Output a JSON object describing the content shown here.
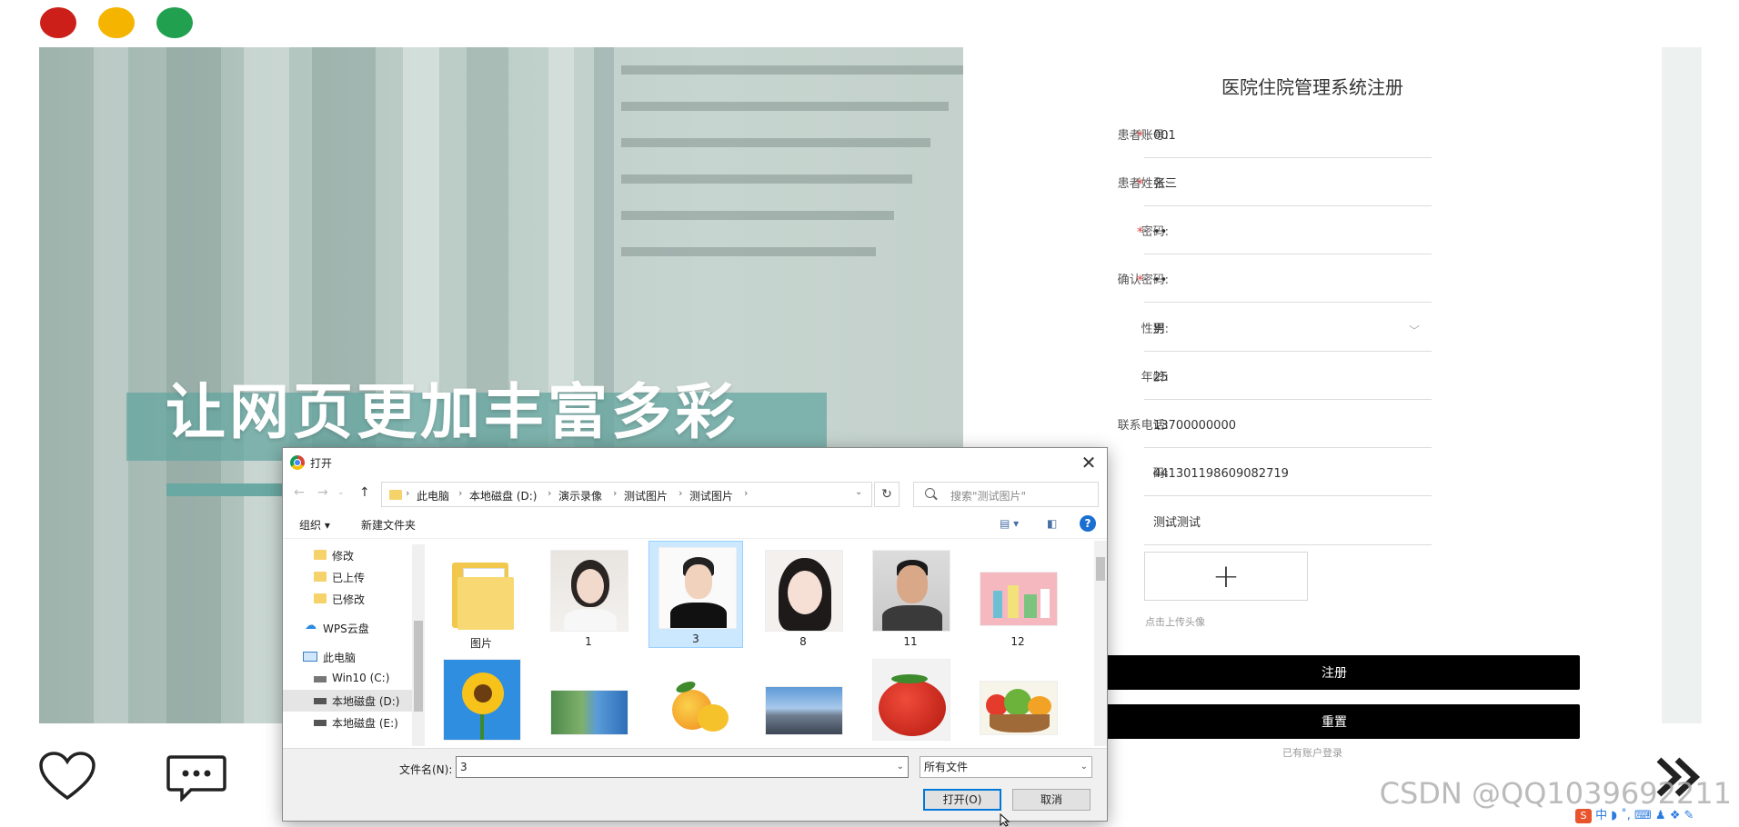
{
  "register": {
    "title": "医院住院管理系统注册",
    "fields": [
      {
        "label": "患者账号:",
        "required": true,
        "value": "001"
      },
      {
        "label": "患者姓名:",
        "required": true,
        "value": "张三"
      },
      {
        "label": "密码:",
        "required": true,
        "value": "••"
      },
      {
        "label": "确认密码:",
        "required": true,
        "value": "••"
      },
      {
        "label": "性别:",
        "required": false,
        "value": "男",
        "select": true
      },
      {
        "label": "年龄:",
        "required": false,
        "value": "25"
      },
      {
        "label": "联系电话:",
        "required": false,
        "value": "13700000000"
      },
      {
        "label": "码:",
        "required": false,
        "value": "441301198609082719"
      },
      {
        "label": ":",
        "required": false,
        "value": "测试测试"
      }
    ],
    "upload_plus": "+",
    "upload_hint": "点击上传头像",
    "submit_label": "注册",
    "reset_label": "重置",
    "login_link": "已有账户登录"
  },
  "hero": {
    "slogan": "让网页更加丰富多彩"
  },
  "dialog": {
    "title": "打开",
    "close": "✕",
    "breadcrumb": [
      "此电脑",
      "本地磁盘 (D:)",
      "演示录像",
      "测试图片",
      "测试图片"
    ],
    "refresh": "↻",
    "search_placeholder": "搜索\"测试图片\"",
    "organize_label": "组织 ▾",
    "new_folder_label": "新建文件夹",
    "help": "?",
    "nav_items": [
      {
        "label": "修改",
        "type": "folder"
      },
      {
        "label": "已上传",
        "type": "folder"
      },
      {
        "label": "已修改",
        "type": "folder"
      },
      {
        "label": "WPS云盘",
        "type": "cloud"
      },
      {
        "label": "此电脑",
        "type": "pc"
      },
      {
        "label": "Win10 (C:)",
        "type": "drive"
      },
      {
        "label": "本地磁盘 (D:)",
        "type": "drive",
        "selected": true
      },
      {
        "label": "本地磁盘 (E:)",
        "type": "drive"
      }
    ],
    "files": [
      {
        "name": "图片",
        "kind": "folder"
      },
      {
        "name": "1",
        "kind": "portrait-woman-1"
      },
      {
        "name": "3",
        "kind": "portrait-man-1",
        "selected": true
      },
      {
        "name": "8",
        "kind": "portrait-woman-2"
      },
      {
        "name": "11",
        "kind": "portrait-man-2"
      },
      {
        "name": "12",
        "kind": "product-photo"
      },
      {
        "name": "",
        "kind": "sunflower"
      },
      {
        "name": "",
        "kind": "building-1"
      },
      {
        "name": "",
        "kind": "mango"
      },
      {
        "name": "",
        "kind": "building-2"
      },
      {
        "name": "",
        "kind": "strawberry"
      },
      {
        "name": "",
        "kind": "vegetables"
      }
    ],
    "filename_label": "文件名(N):",
    "filename_value": "3",
    "filetype_value": "所有文件",
    "open_label": "打开(O)",
    "cancel_label": "取消"
  },
  "watermark": "CSDN @QQ1039692211",
  "tray_text": "中 ◗ ˚, ⌨ ♟ ❖ ✎"
}
